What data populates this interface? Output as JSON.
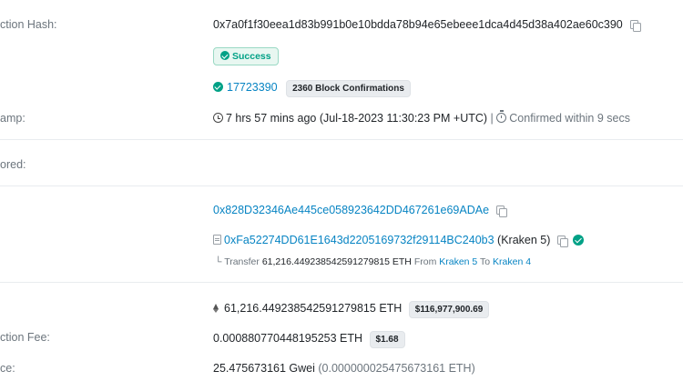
{
  "labels": {
    "tx_hash": "ction Hash:",
    "timestamp": "amp:",
    "sponsored": "ored:",
    "fee": "ction Fee:",
    "gas_price": "ce:"
  },
  "tx": {
    "hash": "0x7a0f1f30eea1d83b991b0e10bdda78b94e65ebeee1dca4d45d38a402ae60c390",
    "status": "Success",
    "block": "17723390",
    "confirmations": "2360 Block Confirmations",
    "time_ago": "7 hrs 57 mins ago (Jul-18-2023 11:30:23 PM +UTC)",
    "separator": "|",
    "confirmed_within": "Confirmed within 9 secs"
  },
  "from": {
    "address": "0x828D32346Ae445ce058923642DD467261e69ADAe"
  },
  "to": {
    "address": "0xFa52274DD61E1643d2205169732f29114BC240b3",
    "name": "(Kraken 5)",
    "transfer_prefix": "Transfer",
    "transfer_amount": "61,216.449238542591279815 ETH",
    "from_word": "From",
    "from_name": "Kraken 5",
    "to_word": "To",
    "to_name": "Kraken 4"
  },
  "value": {
    "eth": "61,216.449238542591279815 ETH",
    "usd": "$116,977,900.69"
  },
  "fee": {
    "eth": "0.000880770448195253 ETH",
    "usd": "$1.68"
  },
  "gas": {
    "gwei": "25.475673161 Gwei",
    "eth": "(0.000000025475673161 ETH)"
  },
  "colors": {
    "link": "#0784c3",
    "success": "#00a186",
    "muted": "#6c757d"
  }
}
